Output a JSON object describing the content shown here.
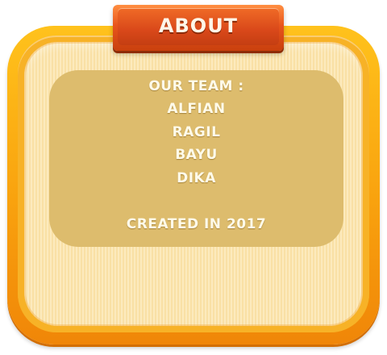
{
  "dialog": {
    "title": "ABOUT",
    "team_heading": "OUR TEAM :",
    "members": [
      "ALFIAN",
      "RAGIL",
      "BAYU",
      "DIKA"
    ],
    "created": "CREATED IN 2017"
  },
  "colors": {
    "frame_orange": "#f9a20e",
    "panel_cream": "#fbe4ab",
    "content_tan": "#ddbc6d",
    "banner_red": "#d9481a",
    "text_cream": "#fffbea"
  }
}
